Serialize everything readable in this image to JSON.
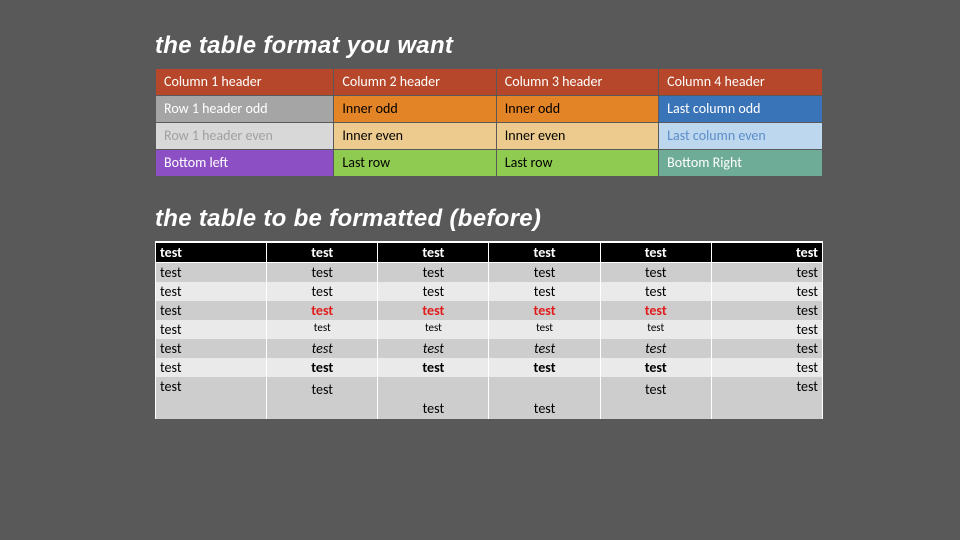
{
  "titles": {
    "target": "the table format you want",
    "before": "the table to be formatted (before)"
  },
  "targetTable": {
    "header": [
      "Column 1 header",
      "Column 2 header",
      "Column 3 header",
      "Column 4 header"
    ],
    "rows": [
      [
        "Row 1 header odd",
        "Inner odd",
        "Inner odd",
        "Last column odd"
      ],
      [
        "Row 1 header even",
        "Inner even",
        "Inner even",
        "Last column even"
      ],
      [
        "Bottom left",
        "Last row",
        "Last row",
        "Bottom Right"
      ]
    ]
  },
  "beforeTable": {
    "header": [
      "test",
      "test",
      "test",
      "test",
      "test",
      "test"
    ],
    "rows": [
      [
        "test",
        "test",
        "test",
        "test",
        "test",
        "test"
      ],
      [
        "test",
        "test",
        "test",
        "test",
        "test",
        "test"
      ],
      [
        "test",
        "test",
        "test",
        "test",
        "test",
        "test"
      ],
      [
        "test",
        "test",
        "test",
        "test",
        "test",
        "test"
      ],
      [
        "test",
        "test",
        "test",
        "test",
        "test",
        "test"
      ],
      [
        "test",
        "test",
        "test",
        "test",
        "test",
        "test"
      ],
      [
        "test",
        "test",
        "test",
        "test",
        "test",
        "test"
      ]
    ]
  }
}
